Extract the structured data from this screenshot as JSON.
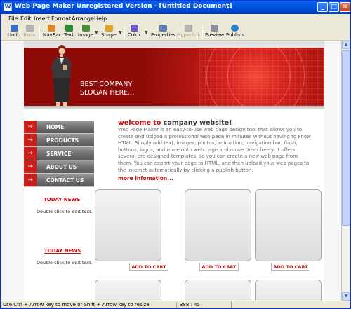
{
  "window": {
    "title": "Web Page Maker Unregistered Version - [Untitled Document]",
    "app_icon": "W",
    "controls": {
      "minimize": "_",
      "maximize": "□",
      "close": "✕"
    }
  },
  "menu": [
    "File",
    "Edit",
    "Insert",
    "Format",
    "Arrange",
    "Help"
  ],
  "toolbar": [
    {
      "label": "Undo",
      "icon": "undo-icon",
      "color": "#3A6FC4",
      "disabled": false
    },
    {
      "label": "Redo",
      "icon": "redo-icon",
      "color": "#B0B0B0",
      "disabled": true
    },
    {
      "label": "NavBar",
      "icon": "navbar-icon",
      "color": "#D98A2B",
      "disabled": false
    },
    {
      "label": "Text",
      "icon": "text-icon",
      "color": "#2E8B3A",
      "disabled": false
    },
    {
      "label": "Image",
      "icon": "image-icon",
      "color": "#4A8F3C",
      "disabled": false
    },
    {
      "label": "Shape",
      "icon": "shape-icon",
      "color": "#D9A52B",
      "disabled": false
    },
    {
      "label": "Color",
      "icon": "color-icon",
      "color": "#6B5BC4",
      "disabled": false
    },
    {
      "label": "Properties",
      "icon": "properties-icon",
      "color": "#5A7FB0",
      "disabled": false
    },
    {
      "label": "Hyperlink",
      "icon": "hyperlink-icon",
      "color": "#B0B0B0",
      "disabled": true
    },
    {
      "label": "Preview",
      "icon": "preview-icon",
      "color": "#8A8FA0",
      "disabled": false
    },
    {
      "label": "Publish",
      "icon": "publish-icon",
      "color": "#2F7FD0",
      "disabled": false
    }
  ],
  "page": {
    "slogan": "BEST COMPANY\nSLOGAN HERE...",
    "nav": [
      "HOME",
      "PRODUCTS",
      "SERVICE",
      "ABOUT US",
      "CONTACT US"
    ],
    "nav_arrow": "→",
    "news": [
      {
        "title": "TODAY   NEWS",
        "text": "Double click to edit text."
      },
      {
        "title": "TODAY   NEWS",
        "text": "Double click to edit text."
      }
    ],
    "welcome_red": "welcome to",
    "welcome_dark": " company website!",
    "body": "Web Page Maker is an easy-to-use web page design tool that allows you to create and upload a professional web page in minutes without having to know HTML. Simply add text, images, photos, animation, navigation bar, flash, buttons, logos, and more onto web page and move them freely. It offers several pre-designed templates, so you can create a new web page from them. You can export your page to HTML, and then upload your web pages to the Internet automatically by clicking a publish button.",
    "more": "more infomation...",
    "cart_label": "ADD TO CART",
    "colors": {
      "accent_red": "#CC1010",
      "banner_red": "#C81F1A",
      "nav_gray": "#6E6E6E"
    }
  },
  "status": {
    "hint": "Use Ctrl + Arrow key to move or Shift + Arrow key to resize",
    "coords": "388 : 45"
  }
}
